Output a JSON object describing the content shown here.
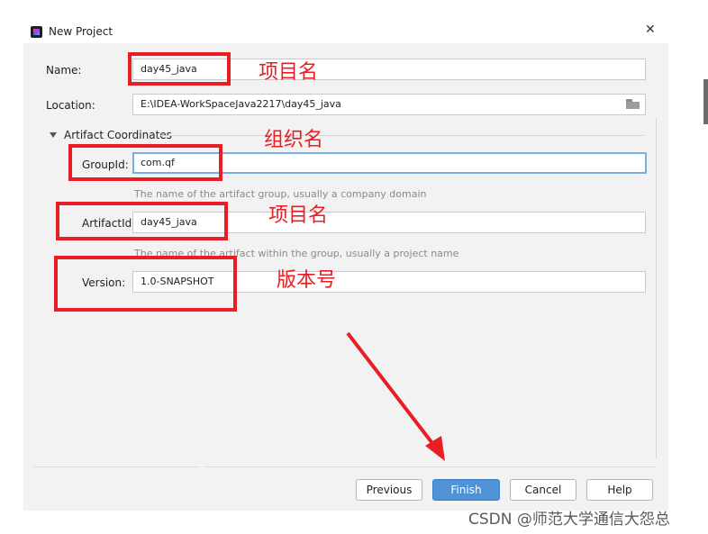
{
  "window": {
    "title": "New Project",
    "close_glyph": "✕"
  },
  "form": {
    "name": {
      "label": "Name:",
      "value": "day45_java"
    },
    "location": {
      "label": "Location:",
      "value": "E:\\IDEA-WorkSpaceJava2217\\day45_java"
    },
    "section_title": "Artifact Coordinates",
    "group_id": {
      "label": "GroupId:",
      "value": "com.qf",
      "hint": "The name of the artifact group, usually a company domain"
    },
    "artifact_id": {
      "label": "ArtifactId:",
      "value": "day45_java",
      "hint": "The name of the artifact within the group, usually a project name"
    },
    "version": {
      "label": "Version:",
      "value": "1.0-SNAPSHOT"
    }
  },
  "buttons": {
    "previous": "Previous",
    "finish": "Finish",
    "cancel": "Cancel",
    "help": "Help"
  },
  "annotations": {
    "name_note": "项目名",
    "group_note": "组织名",
    "artifact_note": "项目名",
    "version_note": "版本号"
  },
  "watermark": "CSDN @师范大学通信大怨总",
  "colors": {
    "annotation": "#e81e25",
    "primary_button": "#4f92d6",
    "focus_border": "#7aaee3"
  },
  "icons": {
    "app": "intellij-idea-icon",
    "folder": "folder-icon",
    "expand": "triangle-down-icon"
  }
}
